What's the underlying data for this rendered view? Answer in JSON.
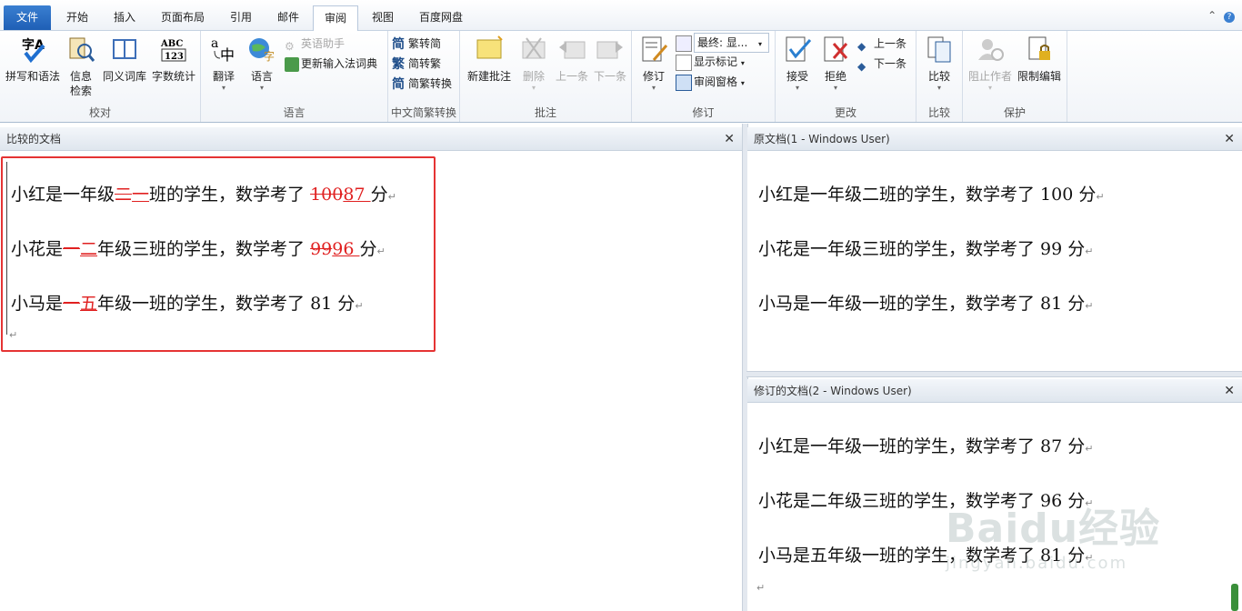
{
  "tabs": [
    {
      "label": "文件"
    },
    {
      "label": "开始"
    },
    {
      "label": "插入"
    },
    {
      "label": "页面布局"
    },
    {
      "label": "引用"
    },
    {
      "label": "邮件"
    },
    {
      "label": "审阅"
    },
    {
      "label": "视图"
    },
    {
      "label": "百度网盘"
    }
  ],
  "ribbon": {
    "proofing": {
      "label": "校对",
      "spelling": "拼写和语法",
      "research_1": "信息",
      "research_2": "检索",
      "thesaurus": "同义词库",
      "wordcount": "字数统计"
    },
    "language": {
      "label": "语言",
      "translate": "翻译",
      "language": "语言",
      "english_assistant": "英语助手",
      "update_ime": "更新输入法词典"
    },
    "chinese": {
      "label": "中文简繁转换",
      "to_trad": "繁转简",
      "to_simp": "简转繁",
      "convert": "简繁转换"
    },
    "comments": {
      "label": "批注",
      "new": "新建批注",
      "delete": "删除",
      "prev": "上一条",
      "next": "下一条"
    },
    "tracking": {
      "label": "修订",
      "track": "修订",
      "display": "最终: 显...",
      "show_markup": "显示标记",
      "reviewing_pane": "审阅窗格"
    },
    "changes": {
      "label": "更改",
      "accept": "接受",
      "reject": "拒绝",
      "prev": "上一条",
      "next": "下一条"
    },
    "compare": {
      "label": "比较",
      "compare": "比较"
    },
    "protect": {
      "label": "保护",
      "block_authors": "阻止作者",
      "restrict": "限制编辑"
    }
  },
  "panes": {
    "compared": {
      "title": "比较的文档"
    },
    "original": {
      "title": "原文档(1 - Windows User)"
    },
    "revised": {
      "title": "修订的文档(2 - Windows User)"
    }
  },
  "compared_lines": [
    {
      "pre": "小红是一年级",
      "del": "二",
      "ins": "一",
      "post": "班的学生，数学考了 ",
      "del2": "100",
      "ins2": "87 ",
      "tail": "分"
    },
    {
      "pre": "小花是",
      "del": "一",
      "ins": "二",
      "post": "年级三班的学生，数学考了 ",
      "del2": "99",
      "ins2": "96 ",
      "tail": "分"
    },
    {
      "pre": "小马是",
      "del": "一",
      "ins": "五",
      "post": "年级一班的学生，数学考了 81 分",
      "del2": "",
      "ins2": "",
      "tail": ""
    }
  ],
  "original_lines": [
    "小红是一年级二班的学生，数学考了 100 分",
    "小花是一年级三班的学生，数学考了 99 分",
    "小马是一年级一班的学生，数学考了 81 分"
  ],
  "revised_lines": [
    "小红是一年级一班的学生，数学考了 87 分",
    "小花是二年级三班的学生，数学考了 96 分",
    "小马是五年级一班的学生，数学考了 81 分"
  ],
  "paragraph_mark": "↵",
  "close_glyph": "✕",
  "watermark": {
    "brand": "Baidu经验",
    "url": "jingyan.baidu.com"
  },
  "colors": {
    "accent": "#1f5fb5",
    "revision": "#e02020",
    "highlight": "#e53333"
  }
}
